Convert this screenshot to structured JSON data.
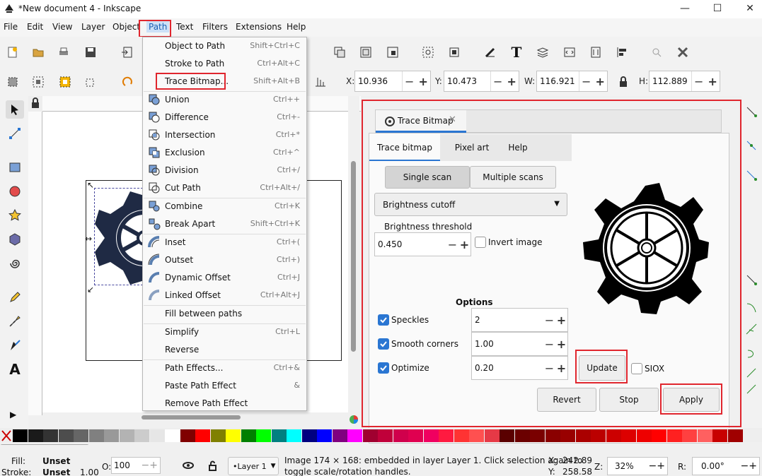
{
  "window": {
    "title": "*New document 4 - Inkscape",
    "min": "—",
    "max": "☐",
    "close": "✕"
  },
  "menubar": [
    "File",
    "Edit",
    "View",
    "Layer",
    "Object",
    "Path",
    "Text",
    "Filters",
    "Extensions",
    "Help"
  ],
  "path_menu": [
    {
      "label": "Object to Path",
      "shortcut": "Shift+Ctrl+C",
      "icon": ""
    },
    {
      "label": "Stroke to Path",
      "shortcut": "Ctrl+Alt+C",
      "icon": ""
    },
    {
      "label": "Trace Bitmap...",
      "shortcut": "Shift+Alt+B",
      "icon": ""
    },
    {
      "label": "Union",
      "shortcut": "Ctrl++",
      "icon": "union-icon"
    },
    {
      "label": "Difference",
      "shortcut": "Ctrl+-",
      "icon": "difference-icon"
    },
    {
      "label": "Intersection",
      "shortcut": "Ctrl+*",
      "icon": "intersection-icon"
    },
    {
      "label": "Exclusion",
      "shortcut": "Ctrl+^",
      "icon": "exclusion-icon"
    },
    {
      "label": "Division",
      "shortcut": "Ctrl+/",
      "icon": "division-icon"
    },
    {
      "label": "Cut Path",
      "shortcut": "Ctrl+Alt+/",
      "icon": "cut-path-icon"
    },
    {
      "label": "Combine",
      "shortcut": "Ctrl+K",
      "icon": "combine-icon"
    },
    {
      "label": "Break Apart",
      "shortcut": "Shift+Ctrl+K",
      "icon": "break-apart-icon"
    },
    {
      "label": "Inset",
      "shortcut": "Ctrl+(",
      "icon": "inset-icon"
    },
    {
      "label": "Outset",
      "shortcut": "Ctrl+)",
      "icon": "outset-icon"
    },
    {
      "label": "Dynamic Offset",
      "shortcut": "Ctrl+J",
      "icon": "dynamic-offset-icon"
    },
    {
      "label": "Linked Offset",
      "shortcut": "Ctrl+Alt+J",
      "icon": "linked-offset-icon"
    },
    {
      "label": "Fill between paths",
      "shortcut": "",
      "icon": ""
    },
    {
      "label": "Simplify",
      "shortcut": "Ctrl+L",
      "icon": ""
    },
    {
      "label": "Reverse",
      "shortcut": "",
      "icon": ""
    },
    {
      "label": "Path Effects...",
      "shortcut": "Ctrl+&",
      "icon": ""
    },
    {
      "label": "Paste Path Effect",
      "shortcut": "&",
      "icon": ""
    },
    {
      "label": "Remove Path Effect",
      "shortcut": "",
      "icon": ""
    }
  ],
  "coords": {
    "x_label": "X:",
    "x": "10.936",
    "y_label": "Y:",
    "y": "10.473",
    "w_label": "W:",
    "w": "116.921",
    "h_label": "H:",
    "h": "112.889"
  },
  "trace": {
    "tab_title": "Trace Bitmap",
    "tabs": [
      "Trace bitmap",
      "Pixel art",
      "Help"
    ],
    "scan_modes": [
      "Single scan",
      "Multiple scans"
    ],
    "mode": "Brightness cutoff",
    "threshold_label": "Brightness threshold",
    "threshold": "0.450",
    "invert_label": "Invert image",
    "options_label": "Options",
    "speckles_label": "Speckles",
    "speckles": "2",
    "smooth_label": "Smooth corners",
    "smooth": "1.00",
    "optimize_label": "Optimize",
    "optimize": "0.20",
    "update": "Update",
    "siox": "SIOX",
    "revert": "Revert",
    "stop": "Stop",
    "apply": "Apply"
  },
  "status": {
    "fill_label": "Fill:",
    "fill": "Unset",
    "stroke_label": "Stroke:",
    "stroke": "Unset",
    "stroke_w": "1.00",
    "opacity_label": "O:",
    "opacity": "100",
    "layer": "•Layer 1",
    "msg1": "Image 174 × 168: embedded in layer Layer 1. Click selection again to",
    "msg2": "toggle scale/rotation handles.",
    "cx_label": "X:",
    "cx": "242.89",
    "cy_label": "Y:",
    "cy": "258.58",
    "zoom_label": "Z:",
    "zoom": "32%",
    "rot_label": "R:",
    "rot": "0.00°"
  },
  "colors": {
    "accent": "#2a76d2",
    "highlight": "#e0262e",
    "gear": "#1f2a44"
  }
}
